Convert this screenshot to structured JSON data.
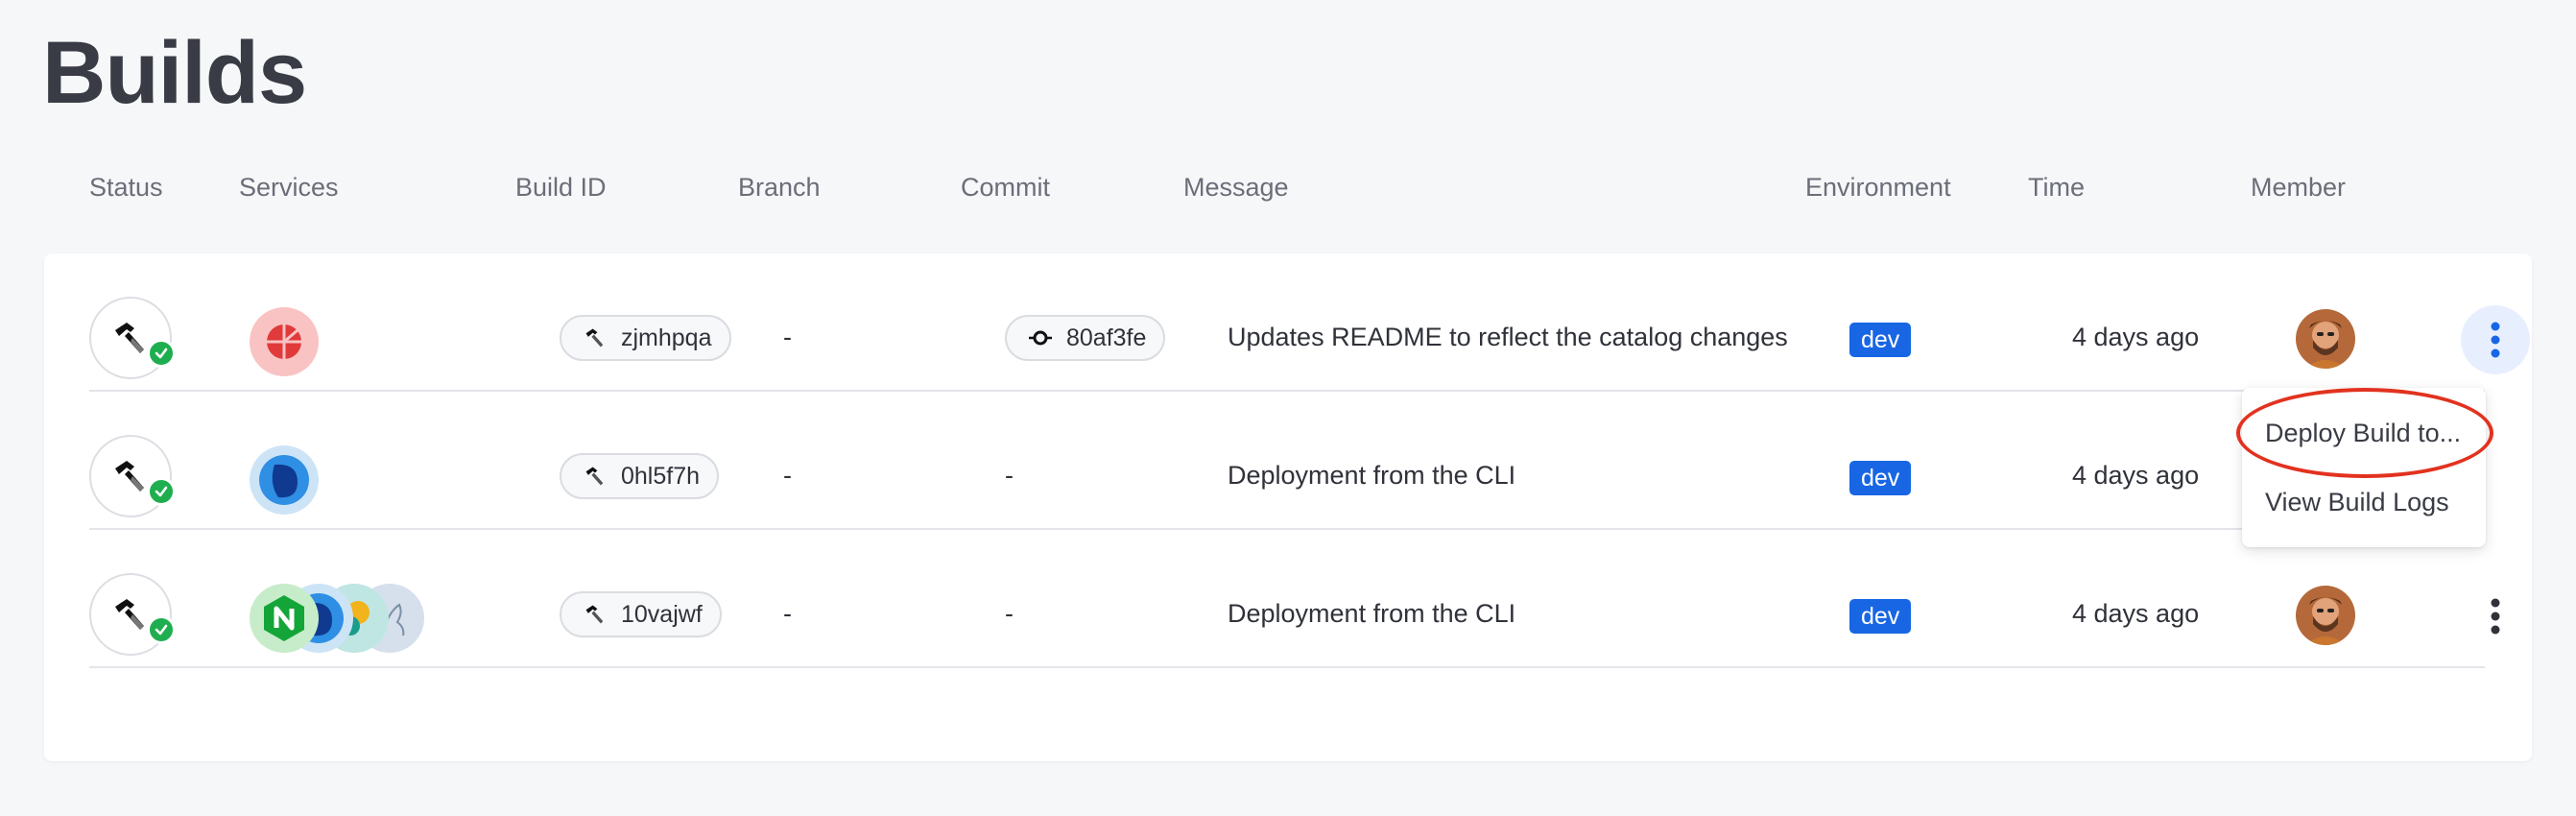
{
  "page": {
    "title": "Builds"
  },
  "columns": {
    "status": "Status",
    "services": "Services",
    "build_id": "Build ID",
    "branch": "Branch",
    "commit": "Commit",
    "message": "Message",
    "environment": "Environment",
    "time": "Time",
    "member": "Member"
  },
  "rows": [
    {
      "status": "success",
      "services": [
        "redis-icon"
      ],
      "build_id": "zjmhpqa",
      "branch": "-",
      "commit": "80af3fe",
      "message": "Updates README to reflect the catalog changes",
      "environment": "dev",
      "time": "4 days ago",
      "member": "avatar"
    },
    {
      "status": "success",
      "services": [
        "service-icon"
      ],
      "build_id": "0hl5f7h",
      "branch": "-",
      "commit": "-",
      "message": "Deployment from the CLI",
      "environment": "dev",
      "time": "4 days ago",
      "member": ""
    },
    {
      "status": "success",
      "services": [
        "nginx-icon",
        "service-icon",
        "service-icon",
        "mysql-icon"
      ],
      "build_id": "10vajwf",
      "branch": "-",
      "commit": "-",
      "message": "Deployment from the CLI",
      "environment": "dev",
      "time": "4 days ago",
      "member": "avatar"
    }
  ],
  "menu": {
    "deploy": "Deploy Build to...",
    "logs": "View Build Logs"
  },
  "colors": {
    "accent": "#1866e4",
    "success": "#1fae4f",
    "highlight": "#e2321f"
  }
}
